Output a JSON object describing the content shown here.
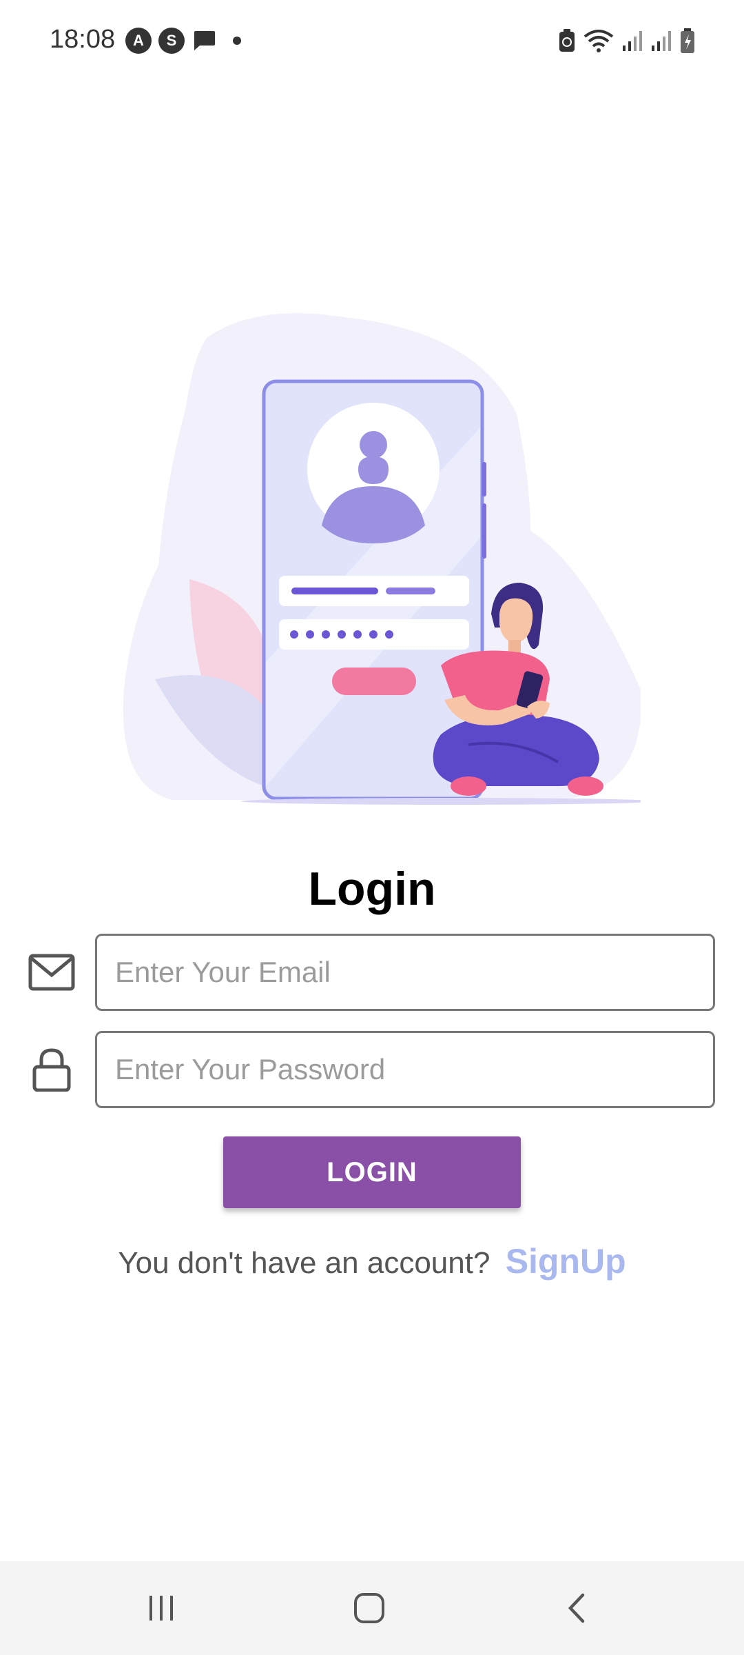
{
  "status_bar": {
    "time": "18:08",
    "icons": [
      "a-app-icon",
      "s-app-icon",
      "chat-bubble-icon",
      "notification-dot-icon",
      "battery-saver-icon",
      "wifi-icon",
      "signal-icon",
      "signal-icon",
      "battery-icon"
    ],
    "app_icon_a": "A",
    "app_icon_s": "S"
  },
  "illustration": {
    "icon": "login-illustration"
  },
  "login": {
    "title": "Login",
    "email_placeholder": "Enter Your Email",
    "email_value": "",
    "password_placeholder": "Enter Your Password",
    "password_value": "",
    "button_label": "LOGIN",
    "signup_prompt": "You don't have an account?",
    "signup_link": "SignUp"
  },
  "colors": {
    "primary": "#8a4fa6",
    "link": "#a9b8ee",
    "illustration_accent": "#7b6fe0",
    "illustration_pink": "#f279a0"
  },
  "nav_bar": {
    "icons": [
      "recent-apps-icon",
      "home-icon",
      "back-icon"
    ]
  }
}
